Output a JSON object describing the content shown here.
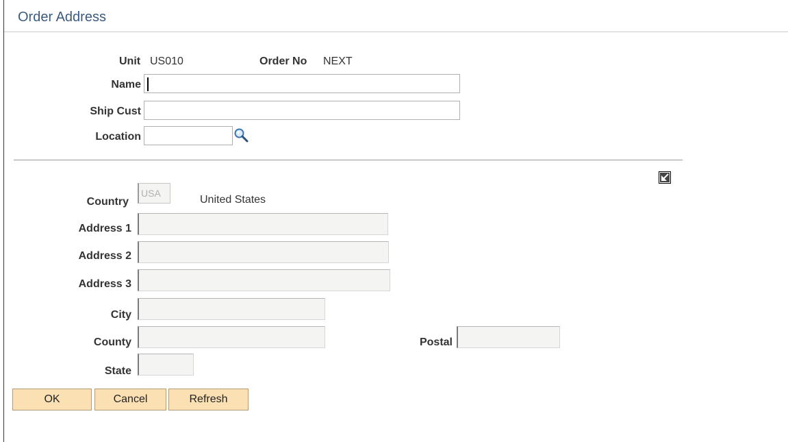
{
  "page": {
    "title": "Order Address"
  },
  "header": {
    "unit_label": "Unit",
    "unit_value": "US010",
    "order_no_label": "Order No",
    "order_no_value": "NEXT",
    "name_label": "Name",
    "name_value": "",
    "ship_cust_label": "Ship Cust",
    "ship_cust_value": "",
    "location_label": "Location",
    "location_value": ""
  },
  "address": {
    "country_label": "Country",
    "country_code": "USA",
    "country_name": "United States",
    "address1_label": "Address 1",
    "address1_value": "",
    "address2_label": "Address 2",
    "address2_value": "",
    "address3_label": "Address 3",
    "address3_value": "",
    "city_label": "City",
    "city_value": "",
    "county_label": "County",
    "county_value": "",
    "postal_label": "Postal",
    "postal_value": "",
    "state_label": "State",
    "state_value": ""
  },
  "buttons": {
    "ok": "OK",
    "cancel": "Cancel",
    "refresh": "Refresh"
  },
  "icons": {
    "location_lookup": "search-icon",
    "expand": "expand-window-icon"
  },
  "colors": {
    "title": "#3a5b80",
    "button_bg": "#fbe0b4",
    "button_border": "#b49a72",
    "disabled_field": "#f4f4f2"
  }
}
